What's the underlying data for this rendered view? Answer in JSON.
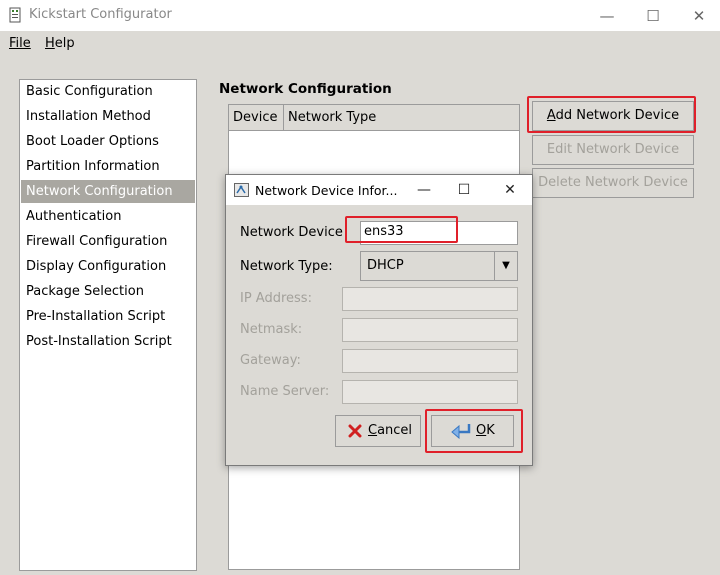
{
  "window": {
    "title": "Kickstart Configurator",
    "minimize": "—",
    "maximize": "☐",
    "close": "✕"
  },
  "menubar": {
    "file": "File",
    "help": "Help"
  },
  "sidebar": {
    "items": [
      "Basic Configuration",
      "Installation Method",
      "Boot Loader Options",
      "Partition Information",
      "Network Configuration",
      "Authentication",
      "Firewall Configuration",
      "Display Configuration",
      "Package Selection",
      "Pre-Installation Script",
      "Post-Installation Script"
    ],
    "selected": "Network Configuration"
  },
  "main": {
    "title": "Network Configuration",
    "table": {
      "columns": [
        "Device",
        "Network Type"
      ]
    },
    "buttons": {
      "add": "Add Network Device",
      "edit": "Edit Network Device",
      "delete": "Delete Network Device"
    }
  },
  "dialog": {
    "title": "Network Device Infor...",
    "minimize": "—",
    "maximize": "☐",
    "close": "✕",
    "fields": {
      "device_label": "Network Device",
      "device_value": "ens33",
      "type_label": "Network Type:",
      "type_value": "DHCP",
      "ip_label": "IP Address:",
      "netmask_label": "Netmask:",
      "gateway_label": "Gateway:",
      "nameserver_label": "Name Server:"
    },
    "buttons": {
      "cancel": "Cancel",
      "ok": "OK"
    }
  },
  "colors": {
    "highlight": "#e0202a",
    "selection": "#a9a7a1",
    "background": "#dcdad5"
  }
}
